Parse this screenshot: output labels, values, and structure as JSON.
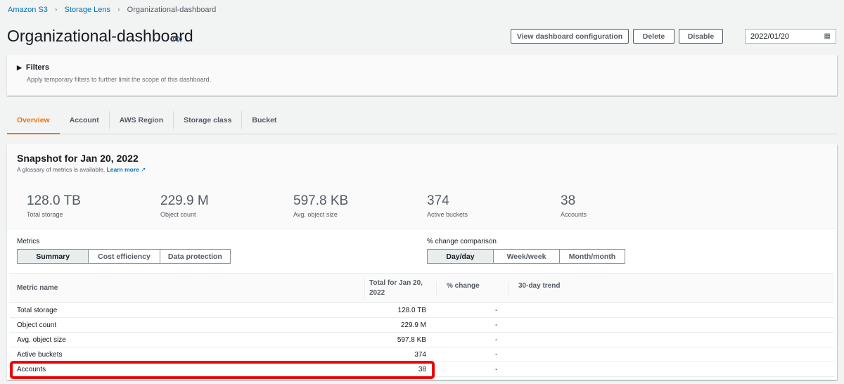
{
  "breadcrumb": [
    "Amazon S3",
    "Storage Lens",
    "Organizational-dashboard"
  ],
  "header": {
    "title": "Organizational-dashboard",
    "info": "Info",
    "buttons": {
      "view_config": "View dashboard configuration",
      "delete": "Delete",
      "disable": "Disable"
    },
    "date": "2022/01/20",
    "date_icon": "calendar-icon"
  },
  "filters": {
    "title": "Filters",
    "description": "Apply temporary filters to further limit the scope of this dashboard."
  },
  "tabs": [
    "Overview",
    "Account",
    "AWS Region",
    "Storage class",
    "Bucket"
  ],
  "snapshot": {
    "title": "Snapshot for Jan 20, 2022",
    "glossary": "A glossary of metrics is available.",
    "learn_more": "Learn more",
    "kpis": [
      {
        "value": "128.0 TB",
        "label": "Total storage"
      },
      {
        "value": "229.9 M",
        "label": "Object count"
      },
      {
        "value": "597.8 KB",
        "label": "Avg. object size"
      },
      {
        "value": "374",
        "label": "Active buckets"
      },
      {
        "value": "38",
        "label": "Accounts"
      }
    ]
  },
  "metrics": {
    "label": "Metrics",
    "options": [
      "Summary",
      "Cost efficiency",
      "Data protection"
    ],
    "selected": "Summary"
  },
  "comparison": {
    "label": "% change comparison",
    "options": [
      "Day/day",
      "Week/week",
      "Month/month"
    ],
    "selected": "Day/day"
  },
  "table": {
    "columns": [
      "Metric name",
      "Total for Jan 20, 2022",
      "% change",
      "30-day trend"
    ],
    "rows": [
      {
        "name": "Total storage",
        "total": "128.0 TB",
        "change": "-"
      },
      {
        "name": "Object count",
        "total": "229.9 M",
        "change": "-"
      },
      {
        "name": "Avg. object size",
        "total": "597.8 KB",
        "change": "-"
      },
      {
        "name": "Active buckets",
        "total": "374",
        "change": "-"
      },
      {
        "name": "Accounts",
        "total": "38",
        "change": "-"
      }
    ]
  },
  "colors": {
    "accent": "#ec7211",
    "link": "#0073bb",
    "highlight": "#ee0000"
  }
}
